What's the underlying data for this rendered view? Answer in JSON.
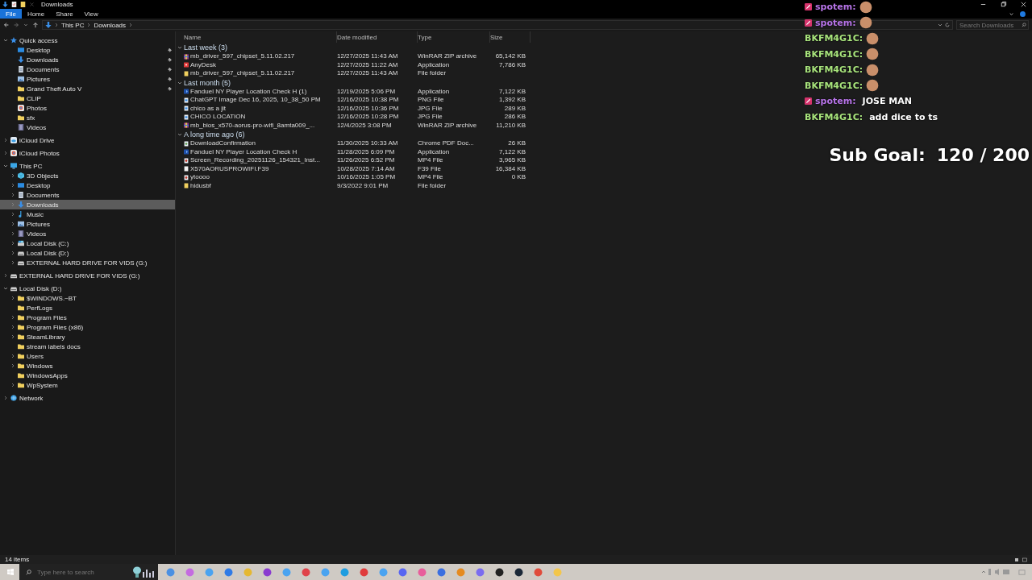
{
  "window": {
    "title": "Downloads"
  },
  "ribbon_tabs": [
    {
      "label": "File",
      "selected": true
    },
    {
      "label": "Home",
      "selected": false
    },
    {
      "label": "Share",
      "selected": false
    },
    {
      "label": "View",
      "selected": false
    }
  ],
  "breadcrumb": [
    "This PC",
    "Downloads"
  ],
  "search": {
    "placeholder": "Search Downloads"
  },
  "sidebar": {
    "items": [
      {
        "label": "Quick access",
        "kind": "star",
        "expandable": true,
        "expanded": true,
        "selected": false,
        "children": [
          {
            "label": "Desktop",
            "kind": "desktop",
            "expandable": false,
            "pinned": true,
            "selected": false
          },
          {
            "label": "Downloads",
            "kind": "download",
            "expandable": false,
            "pinned": true,
            "selected": false
          },
          {
            "label": "Documents",
            "kind": "document",
            "expandable": false,
            "pinned": true,
            "selected": false
          },
          {
            "label": "Pictures",
            "kind": "pictures",
            "expandable": false,
            "pinned": true,
            "selected": false
          },
          {
            "label": "Grand Theft Auto V",
            "kind": "folder",
            "expandable": false,
            "pinned": true,
            "selected": false
          },
          {
            "label": "CLIP",
            "kind": "folder",
            "expandable": false,
            "pinned": false,
            "selected": false
          },
          {
            "label": "Photos",
            "kind": "photos",
            "expandable": false,
            "pinned": false,
            "selected": false
          },
          {
            "label": "sfx",
            "kind": "folder",
            "expandable": false,
            "pinned": false,
            "selected": false
          },
          {
            "label": "Videos",
            "kind": "videos",
            "expandable": false,
            "pinned": false,
            "selected": false
          }
        ]
      },
      {
        "label": "iCloud Drive",
        "kind": "cloud",
        "expandable": true,
        "expanded": false,
        "selected": false
      },
      {
        "label": "iCloud Photos",
        "kind": "photos",
        "expandable": true,
        "expanded": false,
        "selected": false
      },
      {
        "label": "This PC",
        "kind": "pc",
        "expandable": true,
        "expanded": true,
        "selected": false,
        "children": [
          {
            "label": "3D Objects",
            "kind": "cube",
            "expandable": true,
            "expanded": false,
            "selected": false
          },
          {
            "label": "Desktop",
            "kind": "desktop",
            "expandable": true,
            "expanded": false,
            "selected": false
          },
          {
            "label": "Documents",
            "kind": "document",
            "expandable": true,
            "expanded": false,
            "selected": false
          },
          {
            "label": "Downloads",
            "kind": "download",
            "expandable": true,
            "expanded": false,
            "selected": true
          },
          {
            "label": "Music",
            "kind": "music",
            "expandable": true,
            "expanded": false,
            "selected": false
          },
          {
            "label": "Pictures",
            "kind": "pictures",
            "expandable": true,
            "expanded": false,
            "selected": false
          },
          {
            "label": "Videos",
            "kind": "videos",
            "expandable": true,
            "expanded": false,
            "selected": false
          },
          {
            "label": "Local Disk (C:)",
            "kind": "disk",
            "expandable": true,
            "expanded": false,
            "selected": false
          },
          {
            "label": "Local Disk (D:)",
            "kind": "drive",
            "expandable": true,
            "expanded": false,
            "selected": false
          },
          {
            "label": "EXTERNAL HARD DRIVE FOR VIDS (G:)",
            "kind": "drive",
            "expandable": true,
            "expanded": false,
            "selected": false
          }
        ]
      },
      {
        "label": "EXTERNAL HARD DRIVE FOR VIDS (G:)",
        "kind": "drive",
        "expandable": true,
        "expanded": false,
        "selected": false
      },
      {
        "label": "Local Disk (D:)",
        "kind": "drive",
        "expandable": true,
        "expanded": true,
        "selected": false,
        "children": [
          {
            "label": "$WINDOWS.~BT",
            "kind": "folder",
            "expandable": true,
            "expanded": false,
            "selected": false
          },
          {
            "label": "PerfLogs",
            "kind": "folder",
            "expandable": false,
            "selected": false
          },
          {
            "label": "Program Files",
            "kind": "folder",
            "expandable": true,
            "expanded": false,
            "selected": false
          },
          {
            "label": "Program Files (x86)",
            "kind": "folder",
            "expandable": true,
            "expanded": false,
            "selected": false
          },
          {
            "label": "SteamLibrary",
            "kind": "folder",
            "expandable": true,
            "expanded": false,
            "selected": false
          },
          {
            "label": "stream labels docs",
            "kind": "folder",
            "expandable": false,
            "selected": false
          },
          {
            "label": "Users",
            "kind": "folder",
            "expandable": true,
            "expanded": false,
            "selected": false
          },
          {
            "label": "Windows",
            "kind": "folder",
            "expandable": true,
            "expanded": false,
            "selected": false
          },
          {
            "label": "WindowsApps",
            "kind": "folder",
            "expandable": false,
            "selected": false
          },
          {
            "label": "WpSystem",
            "kind": "folder",
            "expandable": true,
            "expanded": false,
            "selected": false
          }
        ]
      },
      {
        "label": "Network",
        "kind": "network",
        "expandable": true,
        "expanded": false,
        "selected": false
      }
    ]
  },
  "file_list": {
    "columns": [
      "Name",
      "Date modified",
      "Type",
      "Size"
    ],
    "groups": [
      {
        "title": "Last week (3)",
        "rows": [
          {
            "name": "mb_driver_597_chipset_5.11.02.217",
            "kind": "archive",
            "date": "12/27/2025 11:43 AM",
            "type": "WinRAR ZIP archive",
            "size": "65,142 KB"
          },
          {
            "name": "AnyDesk",
            "kind": "app-red",
            "date": "12/27/2025 11:22 AM",
            "type": "Application",
            "size": "7,786 KB"
          },
          {
            "name": "mb_driver_597_chipset_5.11.02.217",
            "kind": "folder",
            "date": "12/27/2025 11:43 AM",
            "type": "File folder"
          }
        ]
      },
      {
        "title": "Last month (5)",
        "rows": [
          {
            "name": "Fanduel NY Player Location Check H (1)",
            "kind": "app-blue",
            "date": "12/19/2025 5:06 PM",
            "type": "Application",
            "size": "7,122 KB"
          },
          {
            "name": "ChatGPT Image Dec 16, 2025, 10_38_50 PM",
            "kind": "image",
            "date": "12/16/2025 10:38 PM",
            "type": "PNG File",
            "size": "1,392 KB"
          },
          {
            "name": "chico as a jit",
            "kind": "image",
            "date": "12/16/2025 10:36 PM",
            "type": "JPG File",
            "size": "289 KB"
          },
          {
            "name": "CHICO LOCATION",
            "kind": "image",
            "date": "12/16/2025 10:28 PM",
            "type": "JPG File",
            "size": "286 KB"
          },
          {
            "name": "mb_bios_x570-aorus-pro-wifi_8amta009_...",
            "kind": "archive",
            "date": "12/4/2025 3:08 PM",
            "type": "WinRAR ZIP archive",
            "size": "11,210 KB"
          }
        ]
      },
      {
        "title": "A long time ago (6)",
        "rows": [
          {
            "name": "DownloadConfirmation",
            "kind": "pdf",
            "date": "11/30/2025 10:33 AM",
            "type": "Chrome PDF Doc...",
            "size": "26 KB"
          },
          {
            "name": "Fanduel NY Player Location Check H",
            "kind": "app-blue",
            "date": "11/28/2025 6:09 PM",
            "type": "Application",
            "size": "7,122 KB"
          },
          {
            "name": "Screen_Recording_20251126_154321_Inst...",
            "kind": "video",
            "date": "11/26/2025 6:52 PM",
            "type": "MP4 File",
            "size": "3,965 KB"
          },
          {
            "name": "X570AORUSPROWIFI.F39",
            "kind": "file",
            "date": "10/28/2025 7:14 AM",
            "type": "F39 File",
            "size": "16,384 KB"
          },
          {
            "name": "ytoooo",
            "kind": "video",
            "date": "10/16/2025 1:05 PM",
            "type": "MP4 File",
            "size": "0 KB"
          },
          {
            "name": "hidusbf",
            "kind": "folder",
            "date": "9/3/2022 9:01 PM",
            "type": "File folder"
          }
        ]
      }
    ]
  },
  "status_bar": {
    "count": "14 items"
  },
  "chat": [
    {
      "user": "spotem:",
      "color": "#b774e8",
      "badge": true,
      "emote": true
    },
    {
      "user": "spotem:",
      "color": "#b774e8",
      "badge": true,
      "emote": true
    },
    {
      "user": "BKFM4G1C:",
      "color": "#a8e47c",
      "badge": false,
      "emote": true
    },
    {
      "user": "BKFM4G1C:",
      "color": "#a8e47c",
      "badge": false,
      "emote": true
    },
    {
      "user": "BKFM4G1C:",
      "color": "#a8e47c",
      "badge": false,
      "emote": true
    },
    {
      "user": "BKFM4G1C:",
      "color": "#a8e47c",
      "badge": false,
      "emote": true
    },
    {
      "user": "spotem:",
      "color": "#b774e8",
      "badge": true,
      "emote": false,
      "text": "JOSE MAN"
    },
    {
      "user": "BKFM4G1C:",
      "color": "#a8e47c",
      "badge": false,
      "emote": false,
      "text": "add dice to ts"
    }
  ],
  "sub_goal": {
    "label": "Sub Goal:",
    "value": "120 / 200"
  },
  "taskbar": {
    "search_placeholder": "Type here to search"
  }
}
